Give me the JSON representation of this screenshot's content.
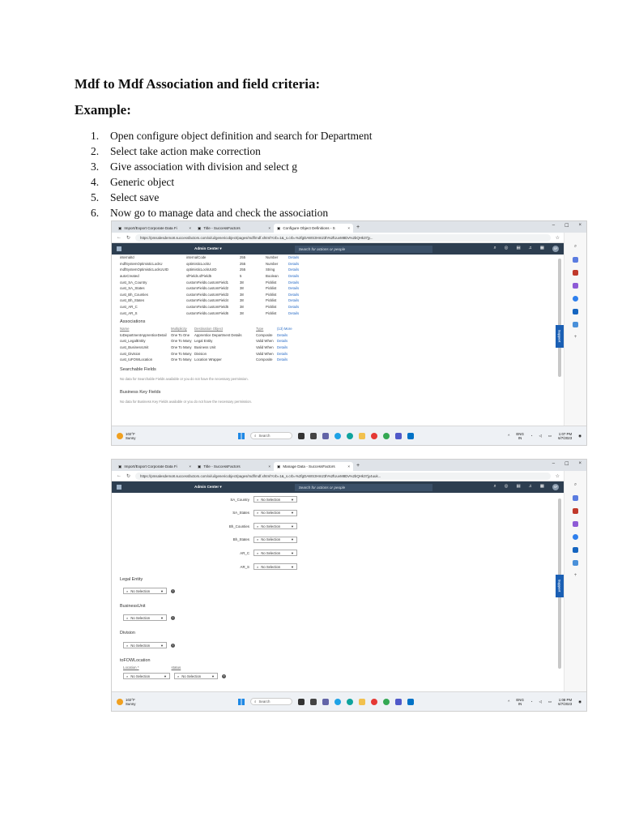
{
  "document": {
    "heading": "Mdf to Mdf Association and field criteria:",
    "subheading": "Example:",
    "steps": [
      {
        "num": "1.",
        "text": "Open configure object definition and search for Department"
      },
      {
        "num": "2.",
        "text": "Select take action make correction"
      },
      {
        "num": "3.",
        "text": "Give association with division and select g"
      },
      {
        "num": "4.",
        "text": "Generic object"
      },
      {
        "num": "5.",
        "text": "Select save"
      },
      {
        "num": "6.",
        "text": "Now go to manage data and check the association"
      }
    ]
  },
  "shot1": {
    "tabs": [
      "Import/Export Corporate Data Fi",
      "Title - SuccessFactors",
      "Configure Object Definitions - S"
    ],
    "url": "https://pmsalesdemo8.successfactors.com/xi/ui/genericobject/pages/mdf/mdf.xhtml?crb=1&_s.crb=%2fgDAWS3Hm23h%2fUuvM8Dv%2bQHk37jy...",
    "admin_center": "Admin Center ▾",
    "search_placeholder": "Search for actions or people",
    "avatar": "SP",
    "field_rows": [
      {
        "name": "internalId",
        "db": "internalCode",
        "len": "255",
        "type": "Number",
        "det": "Details"
      },
      {
        "name": "mdfSystemOptimisticLockU",
        "db": "optimisticLockU",
        "len": "255",
        "type": "Number",
        "det": "Details"
      },
      {
        "name": "mdfSystemOptimisticLockUUID",
        "db": "optimisticLockUUID",
        "len": "255",
        "type": "String",
        "det": "Details"
      },
      {
        "name": "autoCreated",
        "db": "sfFields.sfField5",
        "len": "5",
        "type": "Boolean",
        "det": "Details"
      },
      {
        "name": "cust_SA_Country",
        "db": "customFields.customField1",
        "len": "38",
        "type": "Picklist",
        "det": "Details"
      },
      {
        "name": "cust_SA_States",
        "db": "customFields.customField2",
        "len": "38",
        "type": "Picklist",
        "det": "Details"
      },
      {
        "name": "cust_Bh_Counties",
        "db": "customFields.customField3",
        "len": "38",
        "type": "Picklist",
        "det": "Details"
      },
      {
        "name": "cust_Bh_States",
        "db": "customFields.customField4",
        "len": "38",
        "type": "Picklist",
        "det": "Details"
      },
      {
        "name": "cust_AR_C",
        "db": "customFields.customField5",
        "len": "38",
        "type": "Picklist",
        "det": "Details"
      },
      {
        "name": "cust_AR_S",
        "db": "customFields.customField6",
        "len": "38",
        "type": "Picklist",
        "det": "Details"
      }
    ],
    "associations_title": "Associations",
    "assoc_headers": [
      "Name",
      "Multiplicity",
      "Destination Object",
      "Type",
      "(13) More"
    ],
    "assoc_rows": [
      {
        "name": "toDepartmentApprenticeDetail",
        "mult": "One To One",
        "dest": "Apprentice Department Details",
        "type": "Composite",
        "det": "Details"
      },
      {
        "name": "cust_LegalEntity",
        "mult": "One To Many",
        "dest": "Legal Entity",
        "type": "Valid When",
        "det": "Details"
      },
      {
        "name": "cust_BusinessUnit",
        "mult": "One To Many",
        "dest": "Business Unit",
        "type": "Valid When",
        "det": "Details"
      },
      {
        "name": "cust_Division",
        "mult": "One To Many",
        "dest": "Division",
        "type": "Valid When",
        "det": "Details"
      },
      {
        "name": "cust_toFOWLocation",
        "mult": "One To Many",
        "dest": "Location Wrapper",
        "type": "Composite",
        "det": "Details"
      }
    ],
    "searchable_title": "Searchable Fields",
    "searchable_note": "No data for Searchable Fields available or you do not have the necessary permission.",
    "bkf_title": "Business Key Fields",
    "bkf_note": "No data for Business Key Fields available or you do not have the necessary permission.",
    "weather_temp": "102°F",
    "weather_desc": "Sunny",
    "taskbar_search": "Search",
    "lang": "ENG",
    "lang2": "IN",
    "time": "1:07 PM",
    "date": "6/7/2023"
  },
  "shot2": {
    "tabs": [
      "Import/Export Corporate Data Fi",
      "Title - SuccessFactors",
      "Manage Data - SuccessFactors"
    ],
    "url": "https://pmsalesdemo8.successfactors.com/xi/ui/genericobject/pages/mdf/mdf.xhtml?crb=1&_s.crb=%2fgDAWS3Hm23h%2fUuvM8Dv%2bQHk37jy4uuk...",
    "admin_center": "Admin Center ▾",
    "search_placeholder": "Search for actions or people",
    "avatar": "SP",
    "picklists": [
      {
        "label": "SA_Country",
        "value": "No Selection"
      },
      {
        "label": "SA_States",
        "value": "No Selection"
      },
      {
        "label": "Bh_Counties",
        "value": "No Selection"
      },
      {
        "label": "Bh_States",
        "value": "No Selection"
      },
      {
        "label": "AR_C",
        "value": "No Selection"
      },
      {
        "label": "AR_S",
        "value": "No Selection"
      }
    ],
    "legal_entity": "Legal Entity",
    "business_unit": "BusinessUnit",
    "division": "Division",
    "fow_location": "toFOWLocation",
    "loc_col1": "Location *",
    "loc_col2": "status",
    "no_selection": "No Selection",
    "weather_temp": "102°F",
    "weather_desc": "Sunny",
    "taskbar_search": "Search",
    "lang": "ENG",
    "lang2": "IN",
    "time": "1:08 PM",
    "date": "6/7/2023"
  },
  "colors": {
    "app_header": "#2d3e50",
    "link": "#2a6cc6",
    "support": "#1a5fb4"
  }
}
